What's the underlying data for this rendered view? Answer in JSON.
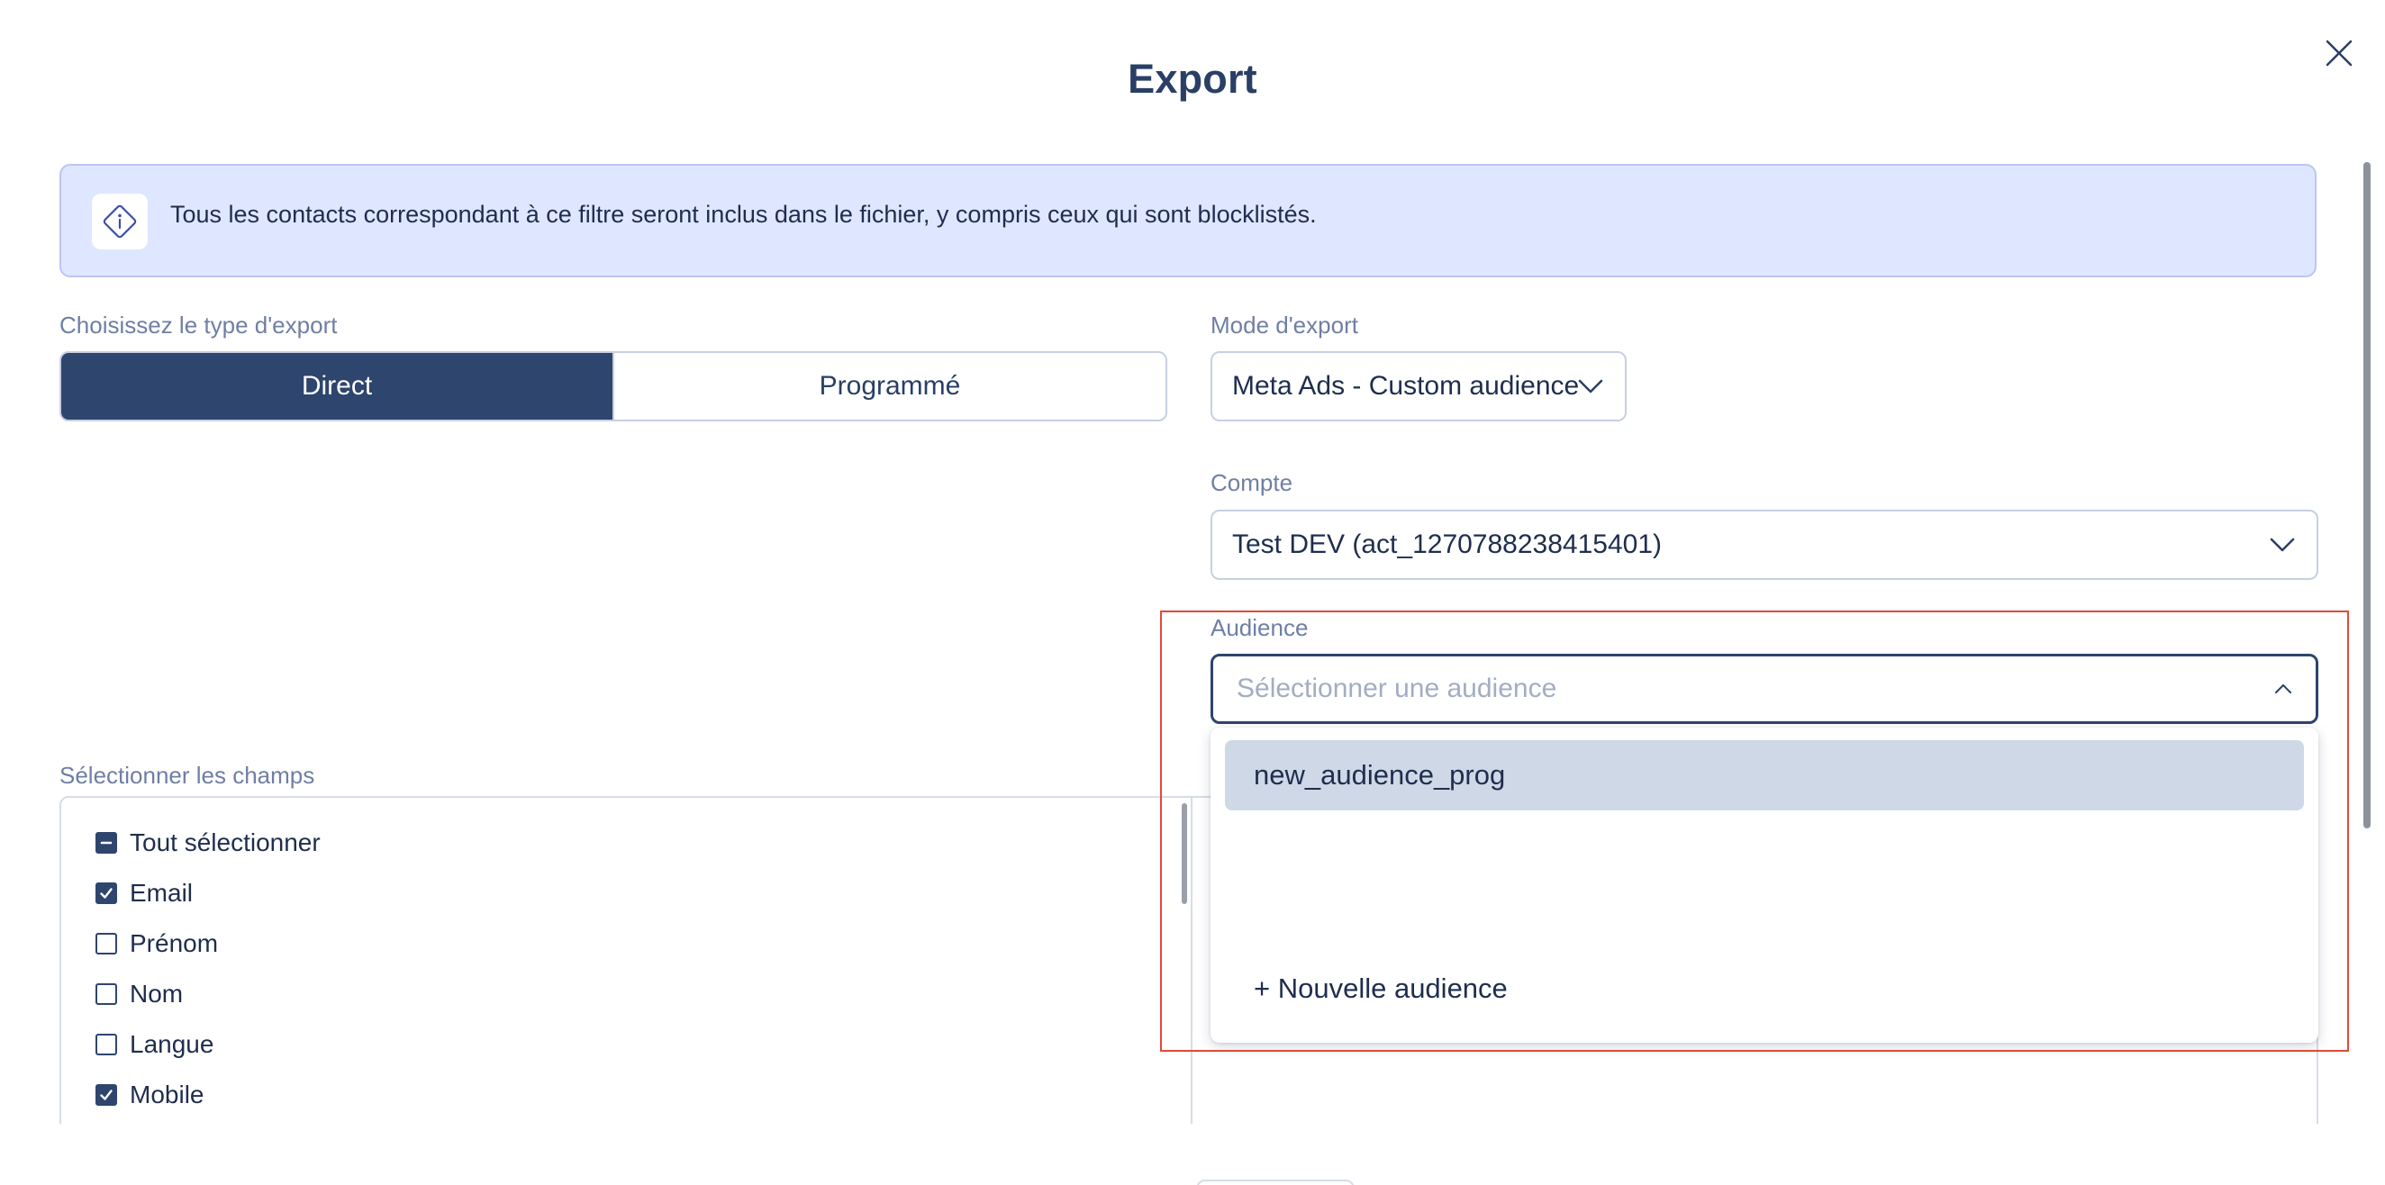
{
  "modal": {
    "title": "Export",
    "close_icon": "close-icon"
  },
  "info_banner": {
    "icon": "info-diamond-icon",
    "text": "Tous les contacts correspondant à ce filtre seront inclus dans le fichier, y compris ceux qui sont blocklistés."
  },
  "export_type": {
    "label": "Choisissez le type d'export",
    "options": [
      {
        "label": "Direct",
        "selected": true
      },
      {
        "label": "Programmé",
        "selected": false
      }
    ]
  },
  "export_mode": {
    "label": "Mode d'export",
    "value": "Meta Ads - Custom audience",
    "icon": "chevron-down-icon"
  },
  "account": {
    "label": "Compte",
    "value": "Test DEV (act_1270788238415401)",
    "icon": "chevron-down-icon"
  },
  "audience": {
    "label": "Audience",
    "placeholder": "Sélectionner une audience",
    "icon": "chevron-up-icon",
    "options": [
      "new_audience_prog"
    ],
    "add_new_label": "+ Nouvelle audience"
  },
  "fields": {
    "label": "Sélectionner les champs",
    "select_all": {
      "label": "Tout sélectionner",
      "state": "indeterminate"
    },
    "items": [
      {
        "label": "Email",
        "checked": true
      },
      {
        "label": "Prénom",
        "checked": false
      },
      {
        "label": "Nom",
        "checked": false
      },
      {
        "label": "Langue",
        "checked": false
      },
      {
        "label": "Mobile",
        "checked": true
      }
    ]
  },
  "colors": {
    "primary": "#2e456d",
    "banner_bg": "#dfe6ff",
    "option_highlight": "#cfd8e6",
    "highlight_border": "#e04a36"
  }
}
